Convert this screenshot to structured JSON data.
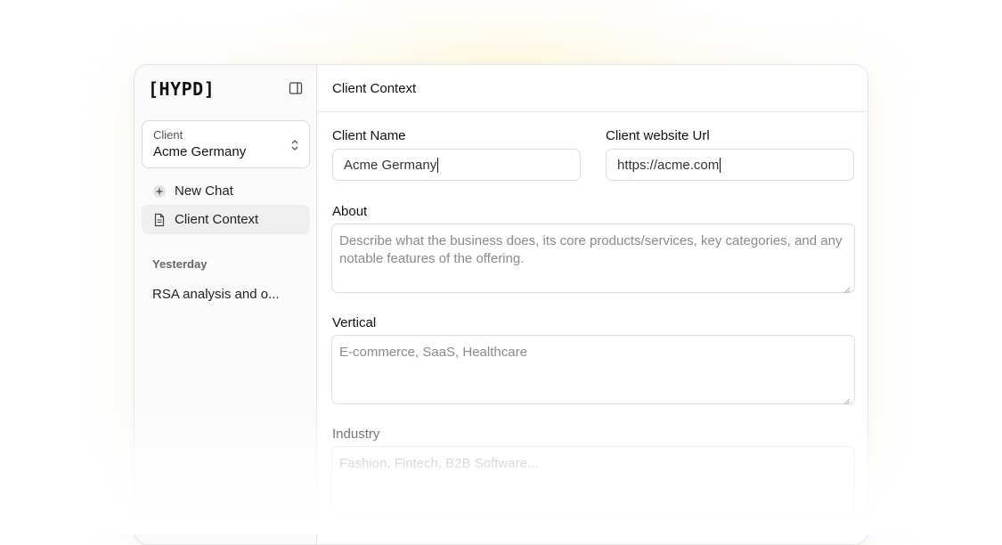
{
  "brand": {
    "logo": "[HYPD]"
  },
  "sidebar": {
    "client_select": {
      "label": "Client",
      "value": "Acme Germany"
    },
    "nav": [
      {
        "label": "New Chat",
        "icon": "plus-icon"
      },
      {
        "label": "Client Context",
        "icon": "document-icon"
      }
    ],
    "history_section": "Yesterday",
    "history": [
      {
        "label": "RSA analysis and o..."
      }
    ]
  },
  "main": {
    "header_title": "Client Context",
    "fields": {
      "client_name": {
        "label": "Client Name",
        "value": "Acme Germany"
      },
      "client_url": {
        "label": "Client website Url",
        "value": "https://acme.com"
      },
      "about": {
        "label": "About",
        "placeholder": "Describe what the business does, its core products/services, key categories, and any notable features of the offering."
      },
      "vertical": {
        "label": "Vertical",
        "placeholder": "E-commerce, SaaS, Healthcare"
      },
      "industry": {
        "label": "Industry",
        "placeholder": "Fashion, Fintech, B2B Software..."
      }
    }
  }
}
